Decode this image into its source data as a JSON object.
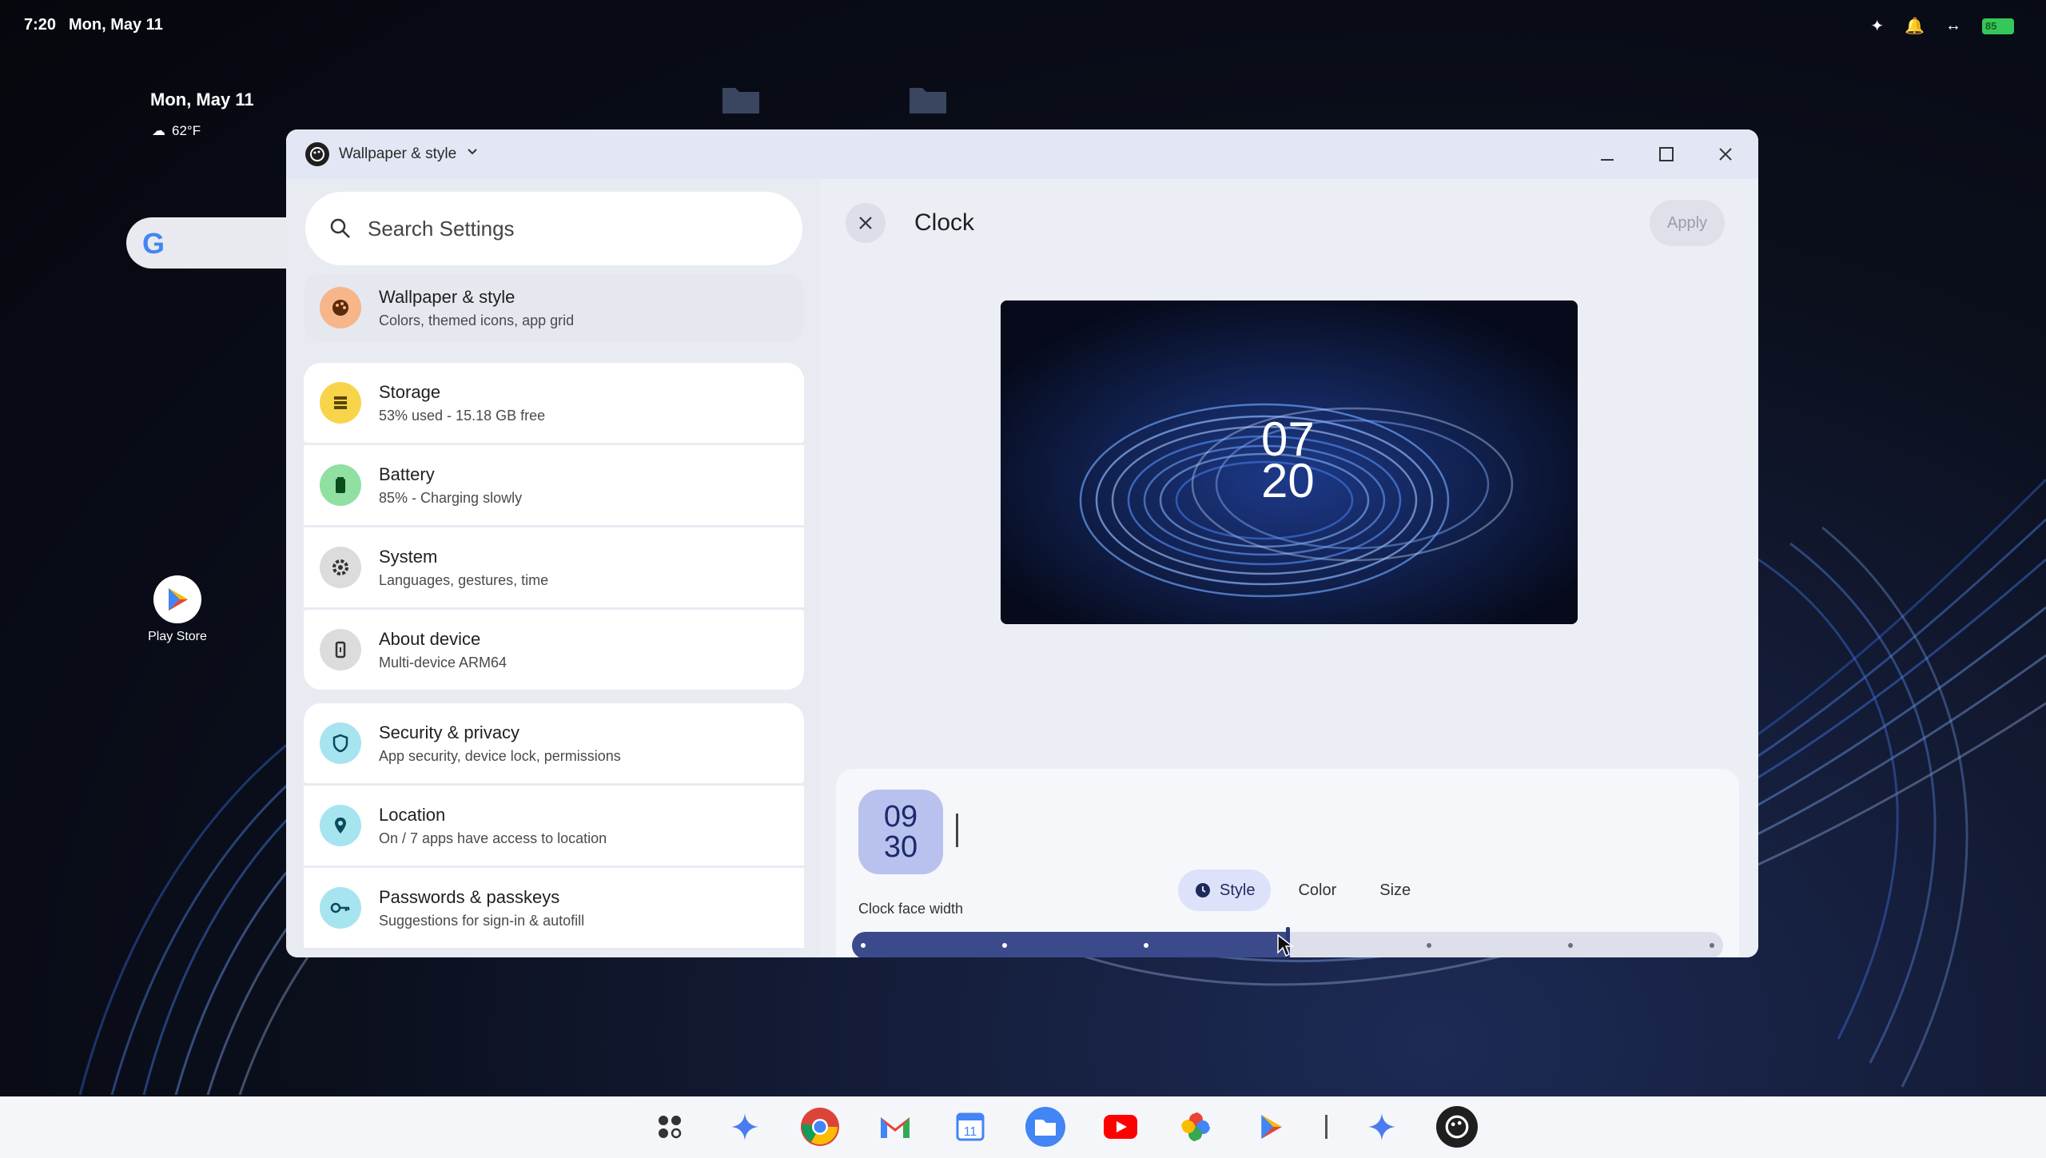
{
  "status_bar": {
    "time": "7:20",
    "date": "Mon, May 11",
    "battery": "85"
  },
  "desktop": {
    "date": "Mon, May 11",
    "weather": "62°F",
    "play_store_label": "Play Store"
  },
  "window": {
    "app_name": "Wallpaper & style"
  },
  "settings": {
    "search_placeholder": "Search Settings",
    "items": [
      {
        "title": "Wallpaper & style",
        "subtitle": "Colors, themed icons, app grid",
        "icon": "palette-icon",
        "color": "#f7b58a"
      },
      {
        "title": "Storage",
        "subtitle": "53% used - 15.18 GB free",
        "icon": "storage-icon",
        "color": "#f7d44a"
      },
      {
        "title": "Battery",
        "subtitle": "85% - Charging slowly",
        "icon": "battery-icon",
        "color": "#8fe0a1"
      },
      {
        "title": "System",
        "subtitle": "Languages, gestures, time",
        "icon": "gear-icon",
        "color": "#dcdcdc"
      },
      {
        "title": "About device",
        "subtitle": "Multi-device ARM64",
        "icon": "device-icon",
        "color": "#dcdcdc"
      },
      {
        "title": "Security & privacy",
        "subtitle": "App security, device lock, permissions",
        "icon": "shield-icon",
        "color": "#a6e4f0"
      },
      {
        "title": "Location",
        "subtitle": "On / 7 apps have access to location",
        "icon": "location-icon",
        "color": "#a6e4f0"
      },
      {
        "title": "Passwords & passkeys",
        "subtitle": "Suggestions for sign-in & autofill",
        "icon": "key-icon",
        "color": "#a6e4f0"
      }
    ]
  },
  "clock": {
    "title": "Clock",
    "apply_label": "Apply",
    "preview_hour": "07",
    "preview_minute": "20",
    "thumb_hour": "09",
    "thumb_minute": "30",
    "slider_label": "Clock face width",
    "slider_value": 0.5,
    "slider_steps": 7,
    "tabs": [
      "Style",
      "Color",
      "Size"
    ],
    "active_tab": "Style"
  }
}
